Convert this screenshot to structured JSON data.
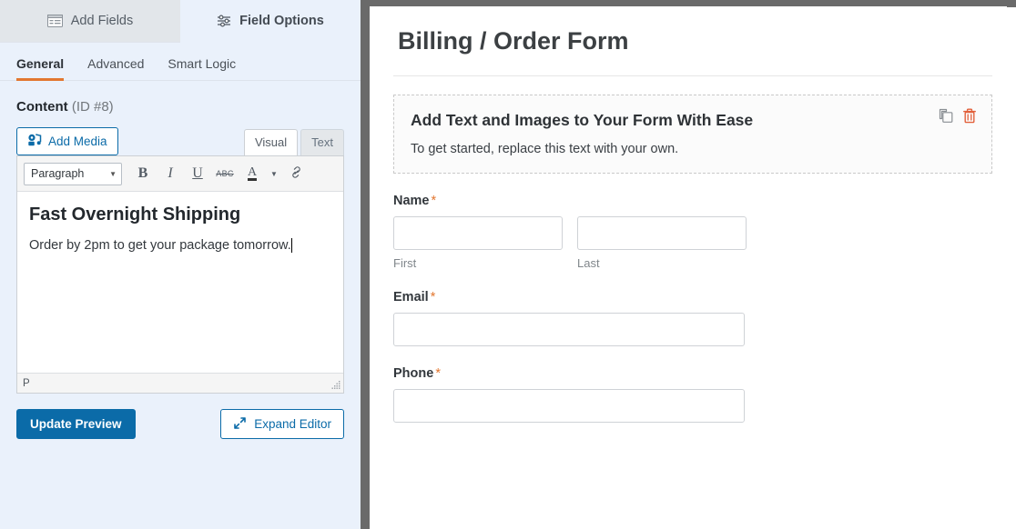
{
  "left_panel": {
    "panel_tabs": [
      {
        "label": "Add Fields",
        "icon": "form-list-icon",
        "active": false
      },
      {
        "label": "Field Options",
        "icon": "sliders-icon",
        "active": true
      }
    ],
    "sub_tabs": [
      {
        "label": "General",
        "active": true
      },
      {
        "label": "Advanced",
        "active": false
      },
      {
        "label": "Smart Logic",
        "active": false
      }
    ],
    "content_section": {
      "label": "Content",
      "field_id": "(ID #8)"
    },
    "add_media_label": "Add Media",
    "editor_tabs": [
      {
        "label": "Visual",
        "active": true
      },
      {
        "label": "Text",
        "active": false
      }
    ],
    "toolbar": {
      "format_select": "Paragraph",
      "bold": "B",
      "italic": "I",
      "underline": "U",
      "strikethrough": "ABC",
      "text_color": "A",
      "link": "link-icon"
    },
    "editor_content": {
      "heading": "Fast Overnight Shipping",
      "paragraph": "Order by 2pm to get your package tomorrow."
    },
    "status_bar": {
      "path": "P"
    },
    "actions": {
      "update_preview": "Update Preview",
      "expand_editor": "Expand Editor"
    }
  },
  "preview": {
    "form_title": "Billing / Order Form",
    "html_block": {
      "heading": "Add Text and Images to Your Form With Ease",
      "text": "To get started, replace this text with your own.",
      "controls": [
        {
          "name": "duplicate-icon",
          "color": "#8a8f94"
        },
        {
          "name": "trash-icon",
          "color": "#e2603b"
        }
      ]
    },
    "fields": [
      {
        "label": "Name",
        "required": "*",
        "type": "name",
        "sub_fields": [
          {
            "sub_label": "First",
            "value": ""
          },
          {
            "sub_label": "Last",
            "value": ""
          }
        ]
      },
      {
        "label": "Email",
        "required": "*",
        "type": "email",
        "value": ""
      },
      {
        "label": "Phone",
        "required": "*",
        "type": "phone",
        "value": ""
      }
    ]
  },
  "colors": {
    "accent_orange": "#e27730",
    "link_blue": "#0b6ba8",
    "panel_bg": "#eaf1fb",
    "divider": "#6a6a6a"
  }
}
